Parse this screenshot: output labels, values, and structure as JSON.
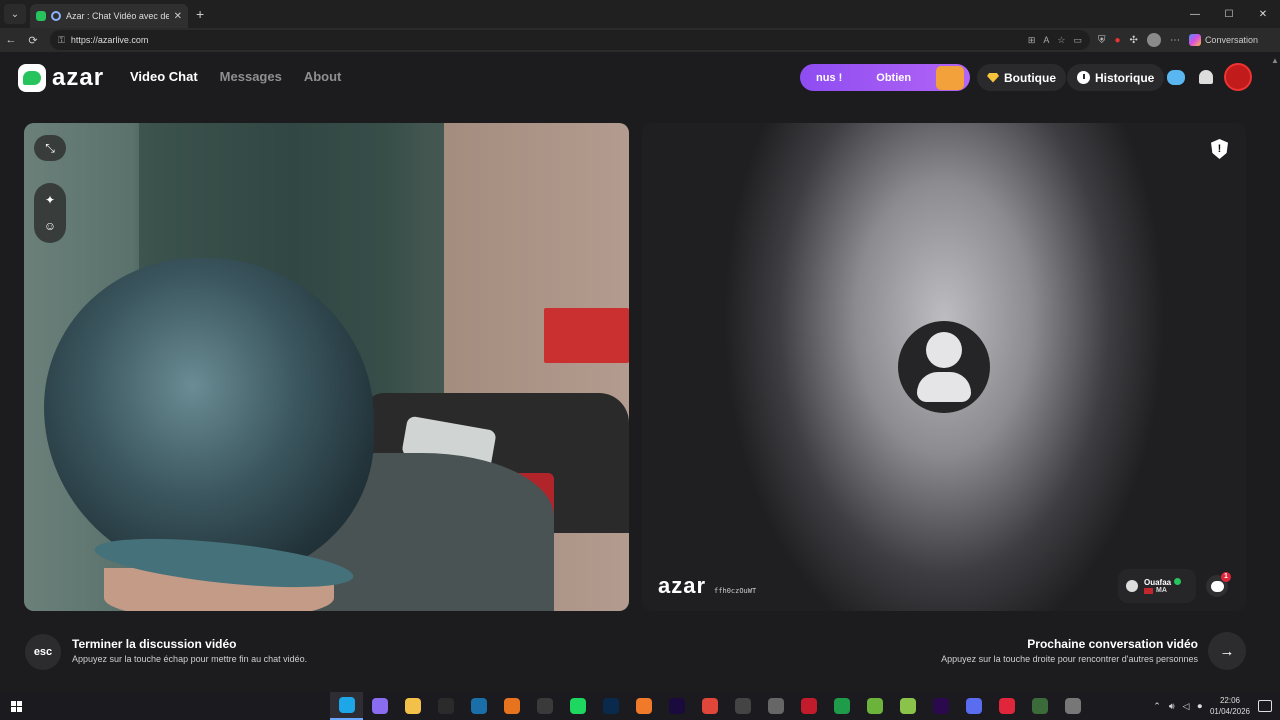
{
  "browser": {
    "tab_title": "Azar : Chat Vidéo avec de nou",
    "new_tab": "+",
    "url": "https://azarlive.com",
    "conversation_label": "Conversation",
    "window_controls": [
      "—",
      "☐",
      "✕"
    ]
  },
  "site": {
    "logo_text": "azar",
    "nav": [
      "Video Chat",
      "Messages",
      "About"
    ],
    "promo": {
      "left": "nus !",
      "right": "Obtien"
    },
    "shop": "Boutique",
    "history": "Historique"
  },
  "video": {
    "watermark": "azar",
    "watermark_code": "ffh0czOuWT",
    "partner_name": "Ouafaa",
    "partner_country": "MA",
    "chat_badge": "1",
    "report_icon": "!"
  },
  "controls": {
    "esc_key": "esc",
    "end_title": "Terminer la discussion vidéo",
    "end_sub": "Appuyez sur la touche échap pour mettre fin au chat vidéo.",
    "next_title": "Prochaine conversation vidéo",
    "next_sub": "Appuyez sur la touche droite pour rencontrer d'autres personnes",
    "next_arrow": "→"
  },
  "taskbar": {
    "time": "22:06",
    "date": "01/04/2026",
    "apps": [
      {
        "name": "edge",
        "color": "#1ea7e8"
      },
      {
        "name": "chat",
        "color": "#8a6cf0"
      },
      {
        "name": "files",
        "color": "#f3c04a"
      },
      {
        "name": "epic",
        "color": "#2b2b2b"
      },
      {
        "name": "steam",
        "color": "#1b6fa8"
      },
      {
        "name": "firefox",
        "color": "#e8731e"
      },
      {
        "name": "obs",
        "color": "#3a3a3a"
      },
      {
        "name": "spotify",
        "color": "#1ed760"
      },
      {
        "name": "photoshop",
        "color": "#0a2a4d"
      },
      {
        "name": "app-orange",
        "color": "#f07a2a"
      },
      {
        "name": "after-effects",
        "color": "#1a0a3d"
      },
      {
        "name": "app-red",
        "color": "#e0463a"
      },
      {
        "name": "app-g",
        "color": "#444"
      },
      {
        "name": "controller",
        "color": "#666"
      },
      {
        "name": "app-red2",
        "color": "#c21b2b"
      },
      {
        "name": "app-green",
        "color": "#1f9c4a"
      },
      {
        "name": "app-stack",
        "color": "#6bb33a"
      },
      {
        "name": "app-tri",
        "color": "#8bc34a"
      },
      {
        "name": "premiere",
        "color": "#2a0a4d"
      },
      {
        "name": "app-blue",
        "color": "#5a6cf0"
      },
      {
        "name": "opera",
        "color": "#e0263b"
      },
      {
        "name": "app-v",
        "color": "#3b6b3b"
      },
      {
        "name": "app-settings",
        "color": "#777"
      }
    ]
  }
}
